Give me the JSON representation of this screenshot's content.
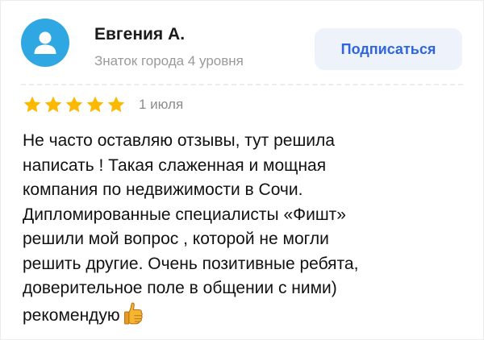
{
  "author": {
    "name": "Евгения А.",
    "level": "Знаток города 4 уровня",
    "avatar_icon": "user-silhouette-icon",
    "avatar_color": "#2fa7e2"
  },
  "subscribe": {
    "label": "Подписаться"
  },
  "review": {
    "rating": 5,
    "rating_max": 5,
    "star_color": "#fcb900",
    "date": "1 июля",
    "lines": [
      "Не часто оставляю отзывы, тут решила",
      "написать ! Такая слаженная и мощная",
      "компания по недвижимости в Сочи.",
      "Дипломированные специалисты «Фишт»",
      "решили мой вопрос , которой не могли",
      "решить другие. Очень позитивные ребята,",
      "доверительное поле в общении с ними)",
      "рекомендую"
    ],
    "emoji_icon": "thumbs-up-icon"
  },
  "colors": {
    "accent": "#2f66dd",
    "button_bg": "#eef2fb",
    "muted_text": "#9a9a9a"
  }
}
